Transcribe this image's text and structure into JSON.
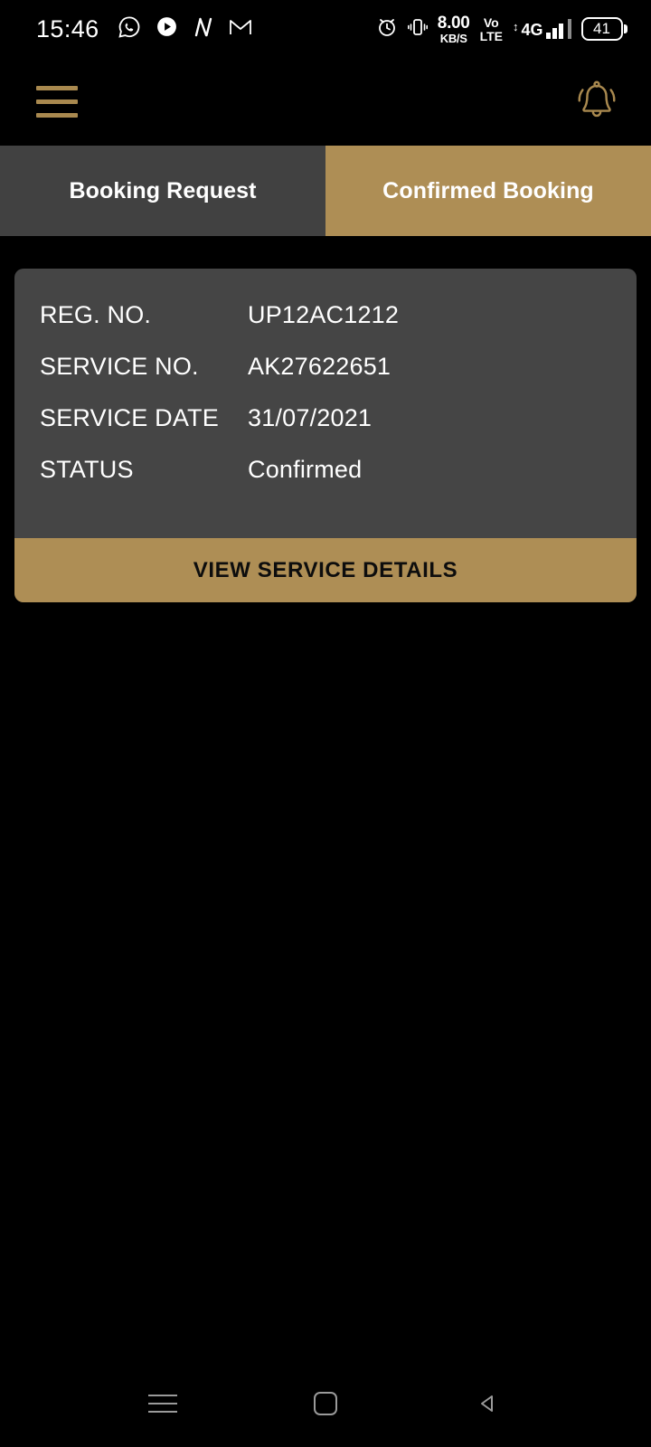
{
  "status_bar": {
    "time": "15:46",
    "left_icons": [
      "whatsapp-icon",
      "play-circle-icon",
      "n-logo-icon",
      "gmail-icon"
    ],
    "alarm_icon": "alarm-icon",
    "vibrate_icon": "vibrate-icon",
    "net_speed_value": "8.00",
    "net_speed_unit": "KB/S",
    "volte_line1": "Vo",
    "volte_line2": "LTE",
    "data_arrows": "↕",
    "network_type": "4G",
    "battery_level": "41"
  },
  "app_header": {
    "menu_icon": "hamburger-menu-icon",
    "notification_icon": "notification-bell-icon"
  },
  "tabs": [
    {
      "label": "Booking Request",
      "active": false
    },
    {
      "label": "Confirmed Booking",
      "active": true
    }
  ],
  "booking_card": {
    "rows": [
      {
        "label": "REG. NO.",
        "value": "UP12AC1212"
      },
      {
        "label": "SERVICE NO.",
        "value": "AK27622651"
      },
      {
        "label": "SERVICE DATE",
        "value": "31/07/2021"
      },
      {
        "label": "STATUS",
        "value": "Confirmed"
      }
    ],
    "action_label": "VIEW SERVICE DETAILS"
  },
  "nav_bar": {
    "recents_label": "recents-icon",
    "home_label": "home-icon",
    "back_label": "back-icon"
  },
  "colors": {
    "background": "#000000",
    "accent_gold": "#ae8e55",
    "card_gray": "#454545",
    "tab_inactive": "#414141",
    "text_primary": "#ffffff",
    "button_text": "#0d0d0d"
  }
}
